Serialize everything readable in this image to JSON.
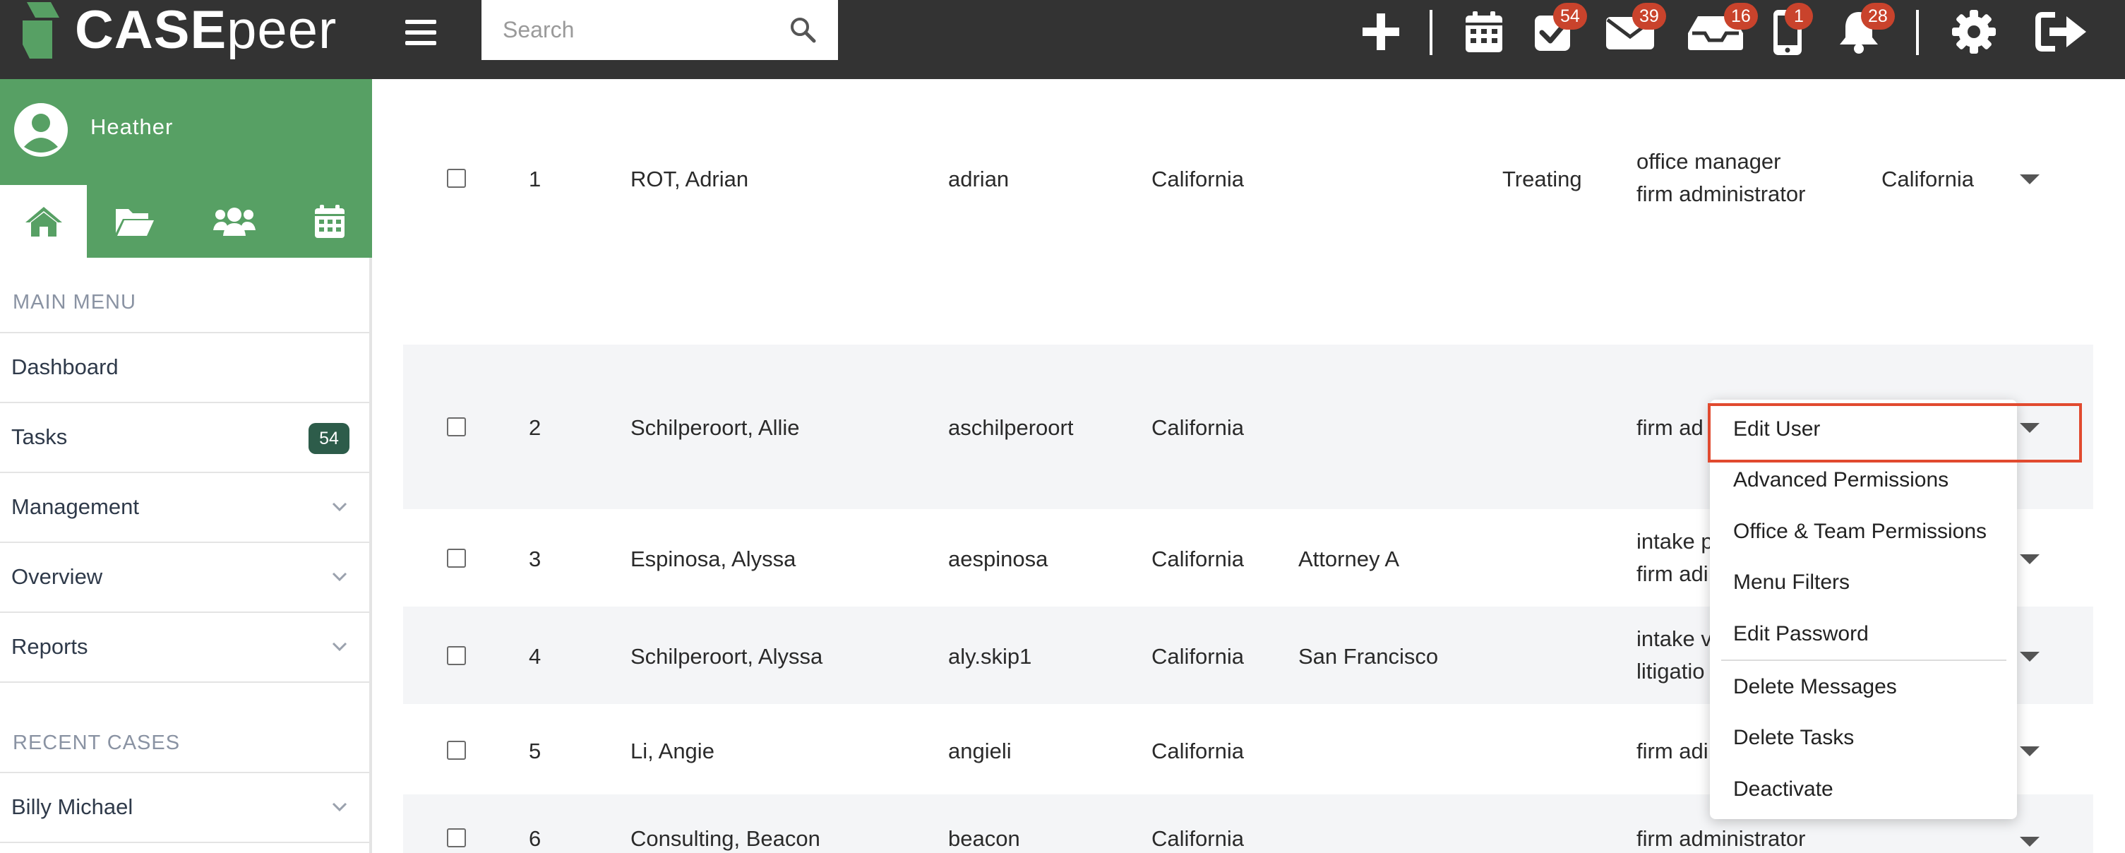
{
  "app": {
    "brand_bold": "CASE",
    "brand_light": "peer"
  },
  "search": {
    "placeholder": "Search"
  },
  "topbar": {
    "icons": [
      {
        "name": "add-icon",
        "badge": ""
      },
      {
        "name": "calendar-icon",
        "badge": ""
      },
      {
        "name": "tasks-check-icon",
        "badge": "54"
      },
      {
        "name": "mail-icon",
        "badge": "39"
      },
      {
        "name": "inbox-icon",
        "badge": "16"
      },
      {
        "name": "phone-icon",
        "badge": "1"
      },
      {
        "name": "bell-icon",
        "badge": "28"
      },
      {
        "name": "gear-icon",
        "badge": ""
      },
      {
        "name": "logout-icon",
        "badge": ""
      }
    ]
  },
  "sidebar": {
    "user_name": "Heather",
    "tabs": [
      "home-icon",
      "folder-icon",
      "users-icon",
      "calendar-icon"
    ],
    "main_menu_label": "MAIN MENU",
    "menu_items": [
      {
        "label": "Dashboard",
        "badge": "",
        "expandable": false
      },
      {
        "label": "Tasks",
        "badge": "54",
        "expandable": false
      },
      {
        "label": "Management",
        "badge": "",
        "expandable": true
      },
      {
        "label": "Overview",
        "badge": "",
        "expandable": true
      },
      {
        "label": "Reports",
        "badge": "",
        "expandable": true
      }
    ],
    "recent_cases_label": "RECENT CASES",
    "recent_cases": [
      {
        "label": "Billy Michael",
        "expandable": true
      }
    ]
  },
  "table": {
    "rows": [
      {
        "num": "1",
        "name": "ROT, Adrian",
        "username": "adrian",
        "state": "California",
        "team": "",
        "status": "Treating",
        "role1": "office manager",
        "role2": "firm administrator",
        "office": "California"
      },
      {
        "num": "2",
        "name": "Schilperoort, Allie",
        "username": "aschilperoort",
        "state": "California",
        "team": "",
        "status": "",
        "role1": "firm ad",
        "role2": "",
        "office": ""
      },
      {
        "num": "3",
        "name": "Espinosa, Alyssa",
        "username": "aespinosa",
        "state": "California",
        "team": "Attorney A",
        "status": "",
        "role1": "intake p",
        "role2": "firm adi",
        "office": ""
      },
      {
        "num": "4",
        "name": "Schilperoort, Alyssa",
        "username": "aly.skip1",
        "state": "California",
        "team": "San Francisco",
        "status": "",
        "role1": "intake v",
        "role2": "litigatio",
        "office": ""
      },
      {
        "num": "5",
        "name": "Li, Angie",
        "username": "angieli",
        "state": "California",
        "team": "",
        "status": "",
        "role1": "firm adi",
        "role2": "",
        "office": ""
      },
      {
        "num": "6",
        "name": "Consulting, Beacon",
        "username": "beacon",
        "state": "California",
        "team": "",
        "status": "",
        "role1": "firm administrator",
        "role2": "",
        "office": ""
      }
    ]
  },
  "dropdown": {
    "items": [
      "Edit User",
      "Advanced Permissions",
      "Office & Team Permissions",
      "Menu Filters",
      "Edit Password",
      "Delete Messages",
      "Delete Tasks",
      "Deactivate"
    ]
  },
  "colors": {
    "topbar": "#333333",
    "brand_green": "#57a064",
    "badge_red": "#c9432c",
    "highlight": "#e14a2f",
    "tasks_badge": "#2d5c4a"
  }
}
